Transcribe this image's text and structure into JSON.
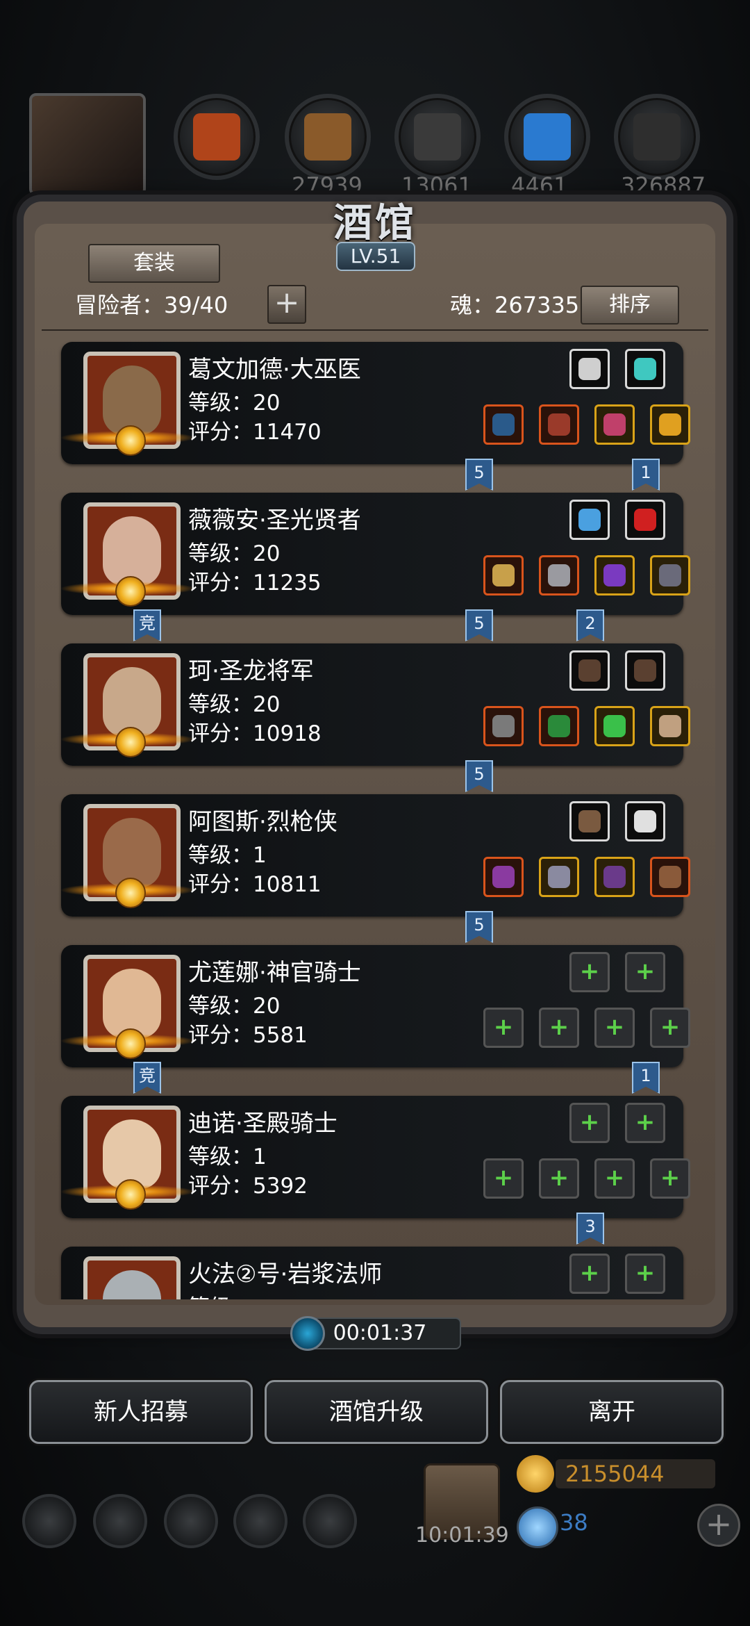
{
  "top_bar": {
    "resources": [
      {
        "icon": "meat-icon",
        "color": "#b0441a",
        "count": ""
      },
      {
        "icon": "wood-icon",
        "color": "#8a5a2a",
        "count": "27939"
      },
      {
        "icon": "stone-icon",
        "color": "#3a3a3a",
        "count": "13061"
      },
      {
        "icon": "crystal-icon",
        "color": "#2a7ad0",
        "count": "4461"
      },
      {
        "icon": "iron-icon",
        "color": "#2e2e2e",
        "count": "326887"
      }
    ]
  },
  "panel": {
    "title": "酒馆",
    "level": "LV.51",
    "set_button": "套装",
    "adventurers": "冒险者：39/40",
    "add_button": "+",
    "soul": "魂：267335",
    "sort_button": "排序"
  },
  "heroes": [
    {
      "name": "葛文加德·大巫医",
      "level": "等级：20",
      "score": "评分：11470",
      "face_color": "#8a6a4a",
      "top_slots": [
        {
          "type": "acc",
          "color": "#cfcfcf"
        },
        {
          "type": "acc",
          "color": "#3fc8c0"
        }
      ],
      "bottom_slots": [
        {
          "type": "red",
          "color": "#2a5a8a"
        },
        {
          "type": "red",
          "color": "#9a3a2a"
        },
        {
          "type": "gold",
          "color": "#c0406a"
        },
        {
          "type": "gold",
          "color": "#e0a020"
        }
      ],
      "ribbons": [
        {
          "label": "5",
          "slot": 1
        },
        {
          "label": "1",
          "slot": 3
        }
      ]
    },
    {
      "name": "薇薇安·圣光贤者",
      "level": "等级：20",
      "score": "评分：11235",
      "face_color": "#d6b09a",
      "top_slots": [
        {
          "type": "acc",
          "color": "#4aa0e0"
        },
        {
          "type": "acc",
          "color": "#d02020"
        }
      ],
      "bottom_slots": [
        {
          "type": "red",
          "color": "#c8a04a"
        },
        {
          "type": "red",
          "color": "#9a9aa0"
        },
        {
          "type": "gold",
          "color": "#7a3ac0"
        },
        {
          "type": "gold",
          "color": "#6a6a7a"
        }
      ],
      "ribbons": [
        {
          "label": "竞",
          "slot": -1
        },
        {
          "label": "5",
          "slot": 1
        },
        {
          "label": "2",
          "slot": 2
        }
      ]
    },
    {
      "name": "珂·圣龙将军",
      "level": "等级：20",
      "score": "评分：10918",
      "face_color": "#c8a88a",
      "top_slots": [
        {
          "type": "acc",
          "color": "#5a4030"
        },
        {
          "type": "acc",
          "color": "#5a4030"
        }
      ],
      "bottom_slots": [
        {
          "type": "red",
          "color": "#7a7a7a"
        },
        {
          "type": "red",
          "color": "#2a8a3a"
        },
        {
          "type": "gold",
          "color": "#3ac04a"
        },
        {
          "type": "gold",
          "color": "#c0a080"
        }
      ],
      "ribbons": [
        {
          "label": "5",
          "slot": 1
        }
      ]
    },
    {
      "name": "阿图斯·烈枪侠",
      "level": "等级：1",
      "score": "评分：10811",
      "face_color": "#9a6a4a",
      "top_slots": [
        {
          "type": "acc",
          "color": "#7a5a40"
        },
        {
          "type": "acc",
          "color": "#e0e0e0"
        }
      ],
      "bottom_slots": [
        {
          "type": "red",
          "color": "#8a3aa0"
        },
        {
          "type": "gold",
          "color": "#8a8aa0"
        },
        {
          "type": "gold",
          "color": "#6a3a8a"
        },
        {
          "type": "red",
          "color": "#8a5a3a"
        }
      ],
      "ribbons": [
        {
          "label": "5",
          "slot": 1
        }
      ]
    },
    {
      "name": "尤莲娜·神官骑士",
      "level": "等级：20",
      "score": "评分：5581",
      "face_color": "#e0b894",
      "top_slots": [
        {
          "type": "empty",
          "color": ""
        },
        {
          "type": "empty",
          "color": ""
        }
      ],
      "bottom_slots": [
        {
          "type": "empty",
          "color": ""
        },
        {
          "type": "empty",
          "color": ""
        },
        {
          "type": "empty",
          "color": ""
        },
        {
          "type": "empty",
          "color": ""
        }
      ],
      "ribbons": [
        {
          "label": "竞",
          "slot": -1
        },
        {
          "label": "1",
          "slot": 3
        }
      ]
    },
    {
      "name": "迪诺·圣殿骑士",
      "level": "等级：1",
      "score": "评分：5392",
      "face_color": "#e6c8a8",
      "top_slots": [
        {
          "type": "empty",
          "color": ""
        },
        {
          "type": "empty",
          "color": ""
        }
      ],
      "bottom_slots": [
        {
          "type": "empty",
          "color": ""
        },
        {
          "type": "empty",
          "color": ""
        },
        {
          "type": "empty",
          "color": ""
        },
        {
          "type": "empty",
          "color": ""
        }
      ],
      "ribbons": [
        {
          "label": "3",
          "slot": 2
        }
      ]
    },
    {
      "name": "火法②号·岩浆法师",
      "level": "等级",
      "score": "",
      "face_color": "#aab0b4",
      "top_slots": [
        {
          "type": "empty",
          "color": ""
        },
        {
          "type": "empty",
          "color": ""
        }
      ],
      "bottom_slots": [],
      "ribbons": []
    }
  ],
  "timer": "00:01:37",
  "buttons": {
    "recruit": "新人招募",
    "upgrade": "酒馆升级",
    "leave": "离开"
  },
  "bottom_bar": {
    "gift_timer": "10:01:39",
    "gold": "2155044",
    "gems": "38"
  }
}
